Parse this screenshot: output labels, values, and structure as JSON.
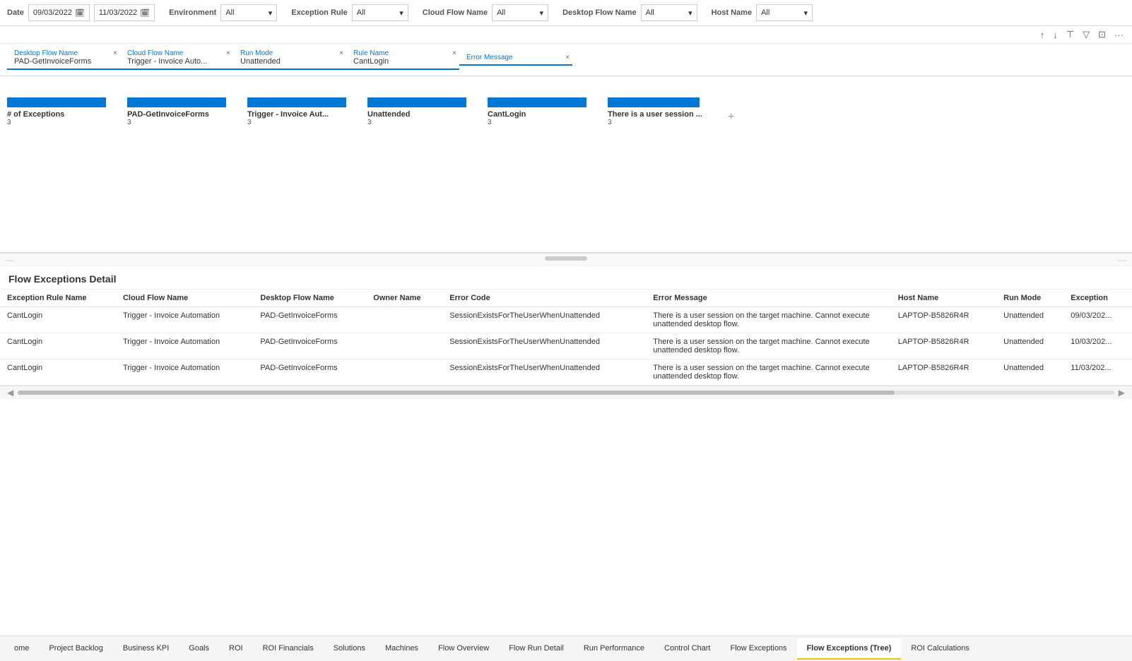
{
  "filterBar": {
    "dateLabel": "Date",
    "dateFrom": "09/03/2022",
    "dateTo": "11/03/2022",
    "environmentLabel": "Environment",
    "environmentValue": "All",
    "exceptionRuleLabel": "Exception Rule",
    "exceptionRuleValue": "All",
    "cloudFlowNameLabel": "Cloud Flow Name",
    "cloudFlowNameValue": "All",
    "desktopFlowNameLabel": "Desktop Flow Name",
    "desktopFlowNameValue": "All",
    "hostNameLabel": "Host Name",
    "hostNameValue": "All"
  },
  "columnFilters": [
    {
      "label": "Desktop Flow Name",
      "value": "PAD-GetInvoiceForms"
    },
    {
      "label": "Cloud Flow Name",
      "value": "Trigger - Invoice Auto..."
    },
    {
      "label": "Run Mode",
      "value": "Unattended"
    },
    {
      "label": "Rule Name",
      "value": "CantLogin"
    },
    {
      "label": "Error Message",
      "value": ""
    }
  ],
  "chartBars": [
    {
      "label": "# of Exceptions",
      "count": "3",
      "barWidth": "140"
    },
    {
      "label": "PAD-GetInvoiceForms",
      "count": "3",
      "barWidth": "140"
    },
    {
      "label": "Trigger - Invoice Aut...",
      "count": "3",
      "barWidth": "140"
    },
    {
      "label": "Unattended",
      "count": "3",
      "barWidth": "140"
    },
    {
      "label": "CantLogin",
      "count": "3",
      "barWidth": "140"
    },
    {
      "label": "There is a user session ...",
      "count": "3",
      "barWidth": "130"
    }
  ],
  "detailSection": {
    "title": "Flow Exceptions Detail",
    "columns": [
      "Exception Rule Name",
      "Cloud Flow Name",
      "Desktop Flow Name",
      "Owner Name",
      "Error Code",
      "Error Message",
      "Host Name",
      "Run Mode",
      "Exception"
    ],
    "rows": [
      {
        "exceptionRuleName": "CantLogin",
        "cloudFlowName": "Trigger - Invoice Automation",
        "desktopFlowName": "PAD-GetInvoiceForms",
        "ownerName": "",
        "errorCode": "SessionExistsForTheUserWhenUnattended",
        "errorMessage": "There is a user session on the target machine. Cannot execute unattended desktop flow.",
        "hostName": "LAPTOP-B5826R4R",
        "runMode": "Unattended",
        "exception": "09/03/202..."
      },
      {
        "exceptionRuleName": "CantLogin",
        "cloudFlowName": "Trigger - Invoice Automation",
        "desktopFlowName": "PAD-GetInvoiceForms",
        "ownerName": "",
        "errorCode": "SessionExistsForTheUserWhenUnattended",
        "errorMessage": "There is a user session on the target machine. Cannot execute unattended desktop flow.",
        "hostName": "LAPTOP-B5826R4R",
        "runMode": "Unattended",
        "exception": "10/03/202..."
      },
      {
        "exceptionRuleName": "CantLogin",
        "cloudFlowName": "Trigger - Invoice Automation",
        "desktopFlowName": "PAD-GetInvoiceForms",
        "ownerName": "",
        "errorCode": "SessionExistsForTheUserWhenUnattended",
        "errorMessage": "There is a user session on the target machine. Cannot execute unattended desktop flow.",
        "hostName": "LAPTOP-B5826R4R",
        "runMode": "Unattended",
        "exception": "11/03/202..."
      }
    ]
  },
  "tabs": [
    {
      "label": "ome",
      "active": false
    },
    {
      "label": "Project Backlog",
      "active": false
    },
    {
      "label": "Business KPI",
      "active": false
    },
    {
      "label": "Goals",
      "active": false
    },
    {
      "label": "ROI",
      "active": false
    },
    {
      "label": "ROI Financials",
      "active": false
    },
    {
      "label": "Solutions",
      "active": false
    },
    {
      "label": "Machines",
      "active": false
    },
    {
      "label": "Flow Overview",
      "active": false
    },
    {
      "label": "Flow Run Detail",
      "active": false
    },
    {
      "label": "Run Performance",
      "active": false
    },
    {
      "label": "Control Chart",
      "active": false
    },
    {
      "label": "Flow Exceptions",
      "active": false
    },
    {
      "label": "Flow Exceptions (Tree)",
      "active": true
    },
    {
      "label": "ROI Calculations",
      "active": false
    }
  ],
  "icons": {
    "sortAsc": "↑",
    "sortDesc": "↓",
    "sortBoth": "⇅",
    "hierarchy": "⊞",
    "filter": "⊟",
    "copy": "⊡",
    "more": "···",
    "chevronDown": "▾",
    "calendar": "📅",
    "close": "×",
    "plus": "+"
  }
}
